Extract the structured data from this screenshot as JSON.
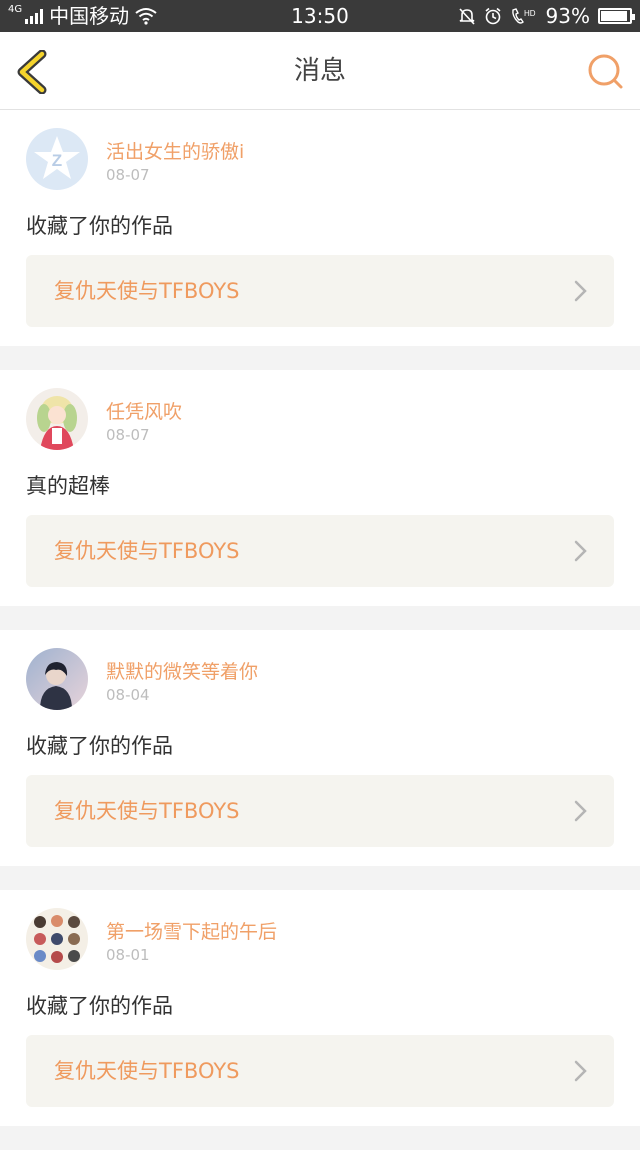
{
  "statusbar": {
    "network": "4G",
    "carrier": "中国移动",
    "time": "13:50",
    "battery_percent": "93%",
    "battery_level": 0.93,
    "icons": [
      "signal-icon",
      "wifi-icon",
      "bell-muted-icon",
      "alarm-icon",
      "hd-call-icon",
      "battery-icon"
    ]
  },
  "header": {
    "title": "消息",
    "back_icon": "chevron-left-icon",
    "search_icon": "search-icon"
  },
  "accent_colors": {
    "name": "#f0a068",
    "back_arrow": "#f5d42c",
    "work_bg": "#f5f4ef"
  },
  "messages": [
    {
      "user": "活出女生的骄傲i",
      "date": "08-07",
      "action": "收藏了你的作品",
      "work_title": "复仇天使与TFBOYS",
      "avatar": "qq-default-avatar"
    },
    {
      "user": "任凭风吹",
      "date": "08-07",
      "action": "真的超棒",
      "work_title": "复仇天使与TFBOYS",
      "avatar": "anime-girl-avatar"
    },
    {
      "user": "默默的微笑等着你",
      "date": "08-04",
      "action": "收藏了你的作品",
      "work_title": "复仇天使与TFBOYS",
      "avatar": "portrait-avatar"
    },
    {
      "user": "第一场雪下起的午后",
      "date": "08-01",
      "action": "收藏了你的作品",
      "work_title": "复仇天使与TFBOYS",
      "avatar": "group-avatar"
    }
  ]
}
